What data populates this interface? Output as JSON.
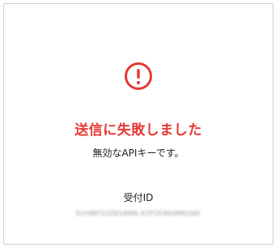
{
  "dialog": {
    "icon": "exclamation-circle-icon",
    "icon_color": "#e53935",
    "title": "送信に失敗しました",
    "title_color": "#e53935",
    "message": "無効なAPIキーです。",
    "receipt_label": "受付ID",
    "receipt_value": "01HWFS2ZK5AM6 K1P2E9K0MKQ6E"
  }
}
